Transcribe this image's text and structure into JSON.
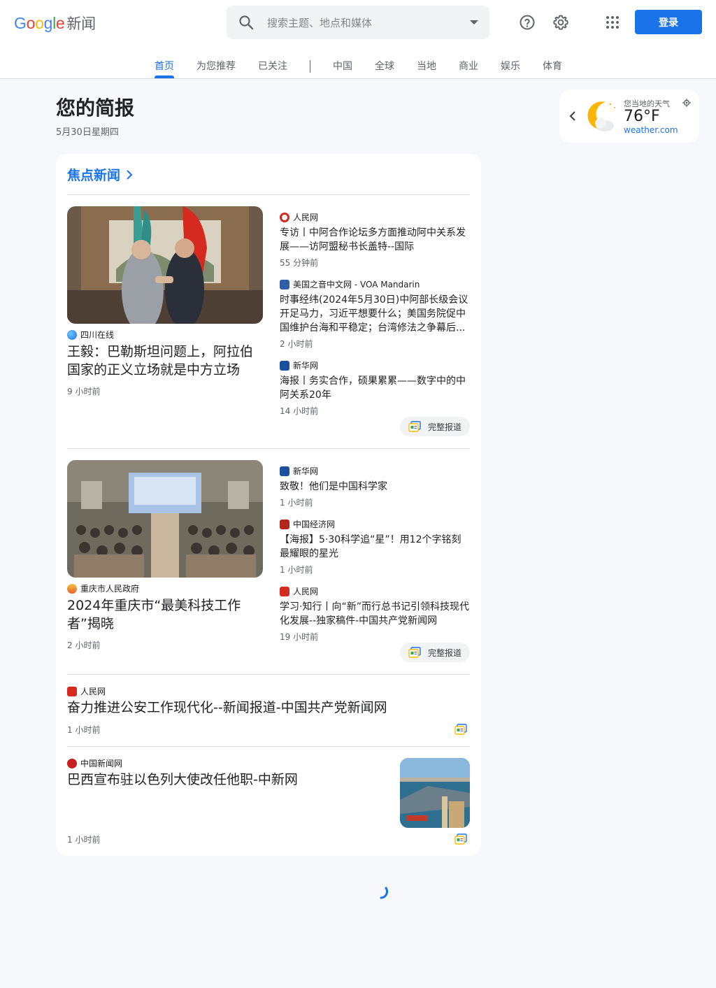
{
  "header": {
    "logo_word": "Google",
    "logo_product": "新闻",
    "search_placeholder": "搜索主题、地点和媒体",
    "login_label": "登录"
  },
  "tabs": [
    {
      "label": "首页"
    },
    {
      "label": "为您推荐"
    },
    {
      "label": "已关注"
    },
    {
      "label": "中国"
    },
    {
      "label": "全球"
    },
    {
      "label": "当地"
    },
    {
      "label": "商业"
    },
    {
      "label": "娱乐"
    },
    {
      "label": "体育"
    }
  ],
  "briefing": {
    "title": "您的简报",
    "date": "5月30日星期四"
  },
  "weather": {
    "label": "您当地的天气",
    "temp": "76°F",
    "source": "weather.com"
  },
  "headlines": {
    "section_title": "焦点新闻",
    "full_coverage_label": "完整报道",
    "cluster1": {
      "main": {
        "source": "四川在线",
        "title": "王毅：巴勒斯坦问题上，阿拉伯国家的正义立场就是中方立场",
        "time": "9 小时前"
      },
      "related": [
        {
          "source": "人民网",
          "title": "专访丨中阿合作论坛多方面推动阿中关系发展——访阿盟秘书长盖特--国际",
          "time": "55 分钟前"
        },
        {
          "source": "美国之音中文网 - VOA Mandarin",
          "title": "时事经纬(2024年5月30日)中阿部长级会议开足马力，习近平想要什么；美国务院促中国维护台海和平稳定；台湾修法之争幕后...",
          "time": "2 小时前"
        },
        {
          "source": "新华网",
          "title": "海报丨务实合作，硕果累累——数字中的中阿关系20年",
          "time": "14 小时前"
        }
      ]
    },
    "cluster2": {
      "main": {
        "source": "重庆市人民政府",
        "title": "2024年重庆市“最美科技工作者”揭晓",
        "time": "2 小时前"
      },
      "related": [
        {
          "source": "新华网",
          "title": "致敬！他们是中国科学家",
          "time": "1 小时前"
        },
        {
          "source": "中国经济网",
          "title": "【海报】5·30科学追“星”！用12个字铭刻最耀眼的星光",
          "time": "1 小时前"
        },
        {
          "source": "人民网",
          "title": "学习·知行丨向“新”而行总书记引领科技现代化发展--独家稿件-中国共产党新闻网",
          "time": "19 小时前"
        }
      ]
    },
    "story3": {
      "source": "人民网",
      "title": "奋力推进公安工作现代化--新闻报道-中国共产党新闻网",
      "time": "1 小时前"
    },
    "story4": {
      "source": "中国新闻网",
      "title": "巴西宣布驻以色列大使改任他职-中新网",
      "time": "1 小时前"
    }
  },
  "colors": {
    "accent": "#1a73e8",
    "background": "#f6f8fc",
    "card": "#ffffff"
  }
}
